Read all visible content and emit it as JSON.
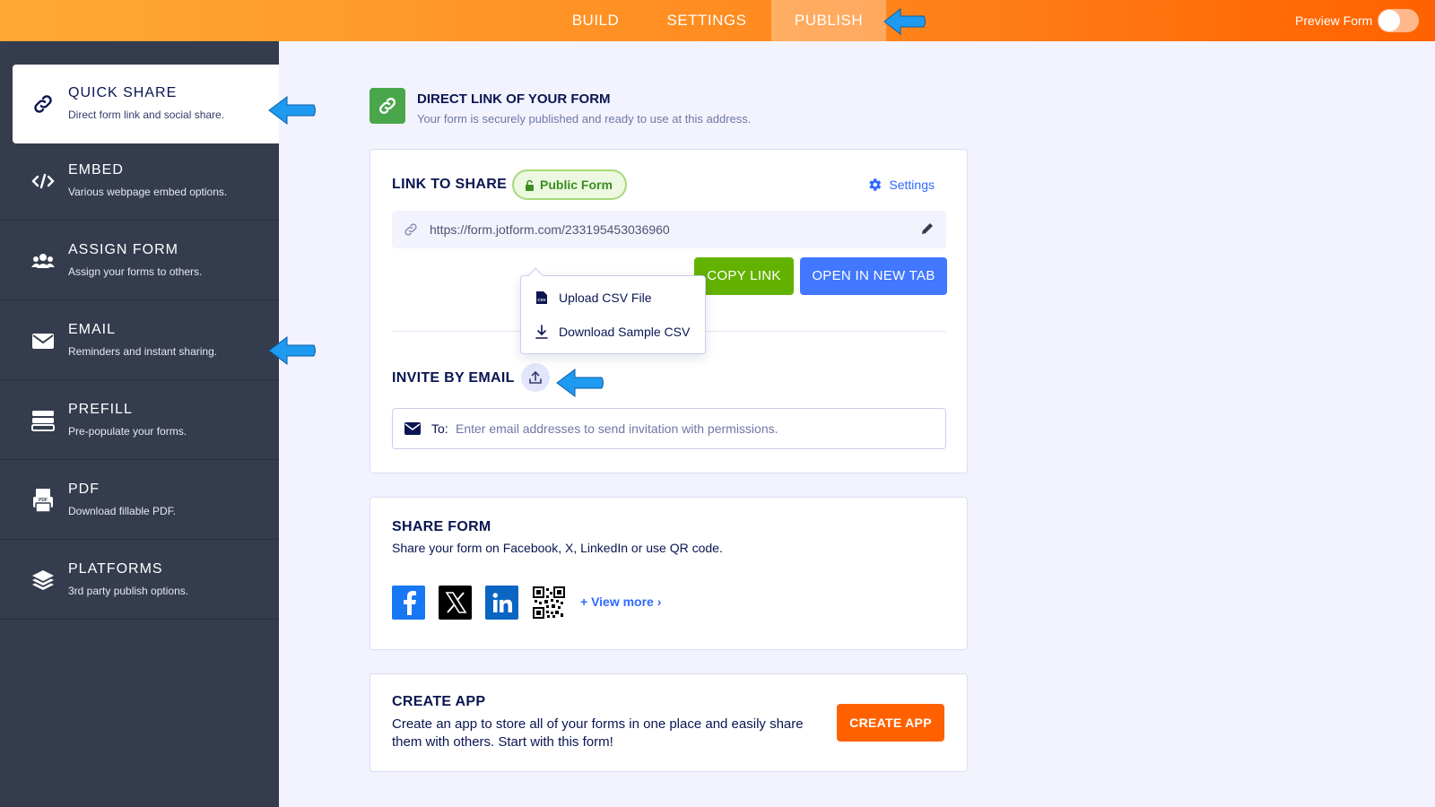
{
  "topbar": {
    "tabs": [
      "BUILD",
      "SETTINGS",
      "PUBLISH"
    ],
    "active_tab": "PUBLISH",
    "preview_label": "Preview Form",
    "preview_toggle_on": false
  },
  "sidebar": {
    "items": [
      {
        "title": "QUICK SHARE",
        "desc": "Direct form link and social share.",
        "icon": "link-icon",
        "active": true
      },
      {
        "title": "EMBED",
        "desc": "Various webpage embed options.",
        "icon": "code-icon"
      },
      {
        "title": "ASSIGN FORM",
        "desc": "Assign your forms to others.",
        "icon": "users-icon"
      },
      {
        "title": "EMAIL",
        "desc": "Reminders and instant sharing.",
        "icon": "envelope-icon"
      },
      {
        "title": "PREFILL",
        "desc": "Pre-populate your forms.",
        "icon": "prefill-icon"
      },
      {
        "title": "PDF",
        "desc": "Download fillable PDF.",
        "icon": "pdf-icon"
      },
      {
        "title": "PLATFORMS",
        "desc": "3rd party publish options.",
        "icon": "layers-icon"
      }
    ]
  },
  "direct_link": {
    "title": "DIRECT LINK OF YOUR FORM",
    "subtitle": "Your form is securely published and ready to use at this address."
  },
  "link_card": {
    "label": "LINK TO SHARE",
    "badge": "Public Form",
    "settings": "Settings",
    "url": "https://form.jotform.com/233195453036960",
    "copy_button": "COPY LINK",
    "open_button": "OPEN IN NEW TAB",
    "invite_label": "INVITE BY EMAIL",
    "email_to": "To:",
    "email_placeholder": "Enter email addresses to send invitation with permissions."
  },
  "dropdown": {
    "items": [
      "Upload CSV File",
      "Download Sample CSV"
    ]
  },
  "share_card": {
    "title": "SHARE FORM",
    "desc": "Share your form on Facebook, X, LinkedIn or use QR code.",
    "view_more": "+ View more ›"
  },
  "app_card": {
    "title": "CREATE APP",
    "desc": "Create an app to store all of your forms in one place and easily share them with others. Start with this form!",
    "button": "CREATE APP"
  },
  "colors": {
    "accent_orange": "#ff6100",
    "copy_green": "#64b200",
    "open_blue": "#4277ff",
    "sidebar_bg": "#343c4e",
    "annotation_arrow": "#1e9bf0"
  }
}
